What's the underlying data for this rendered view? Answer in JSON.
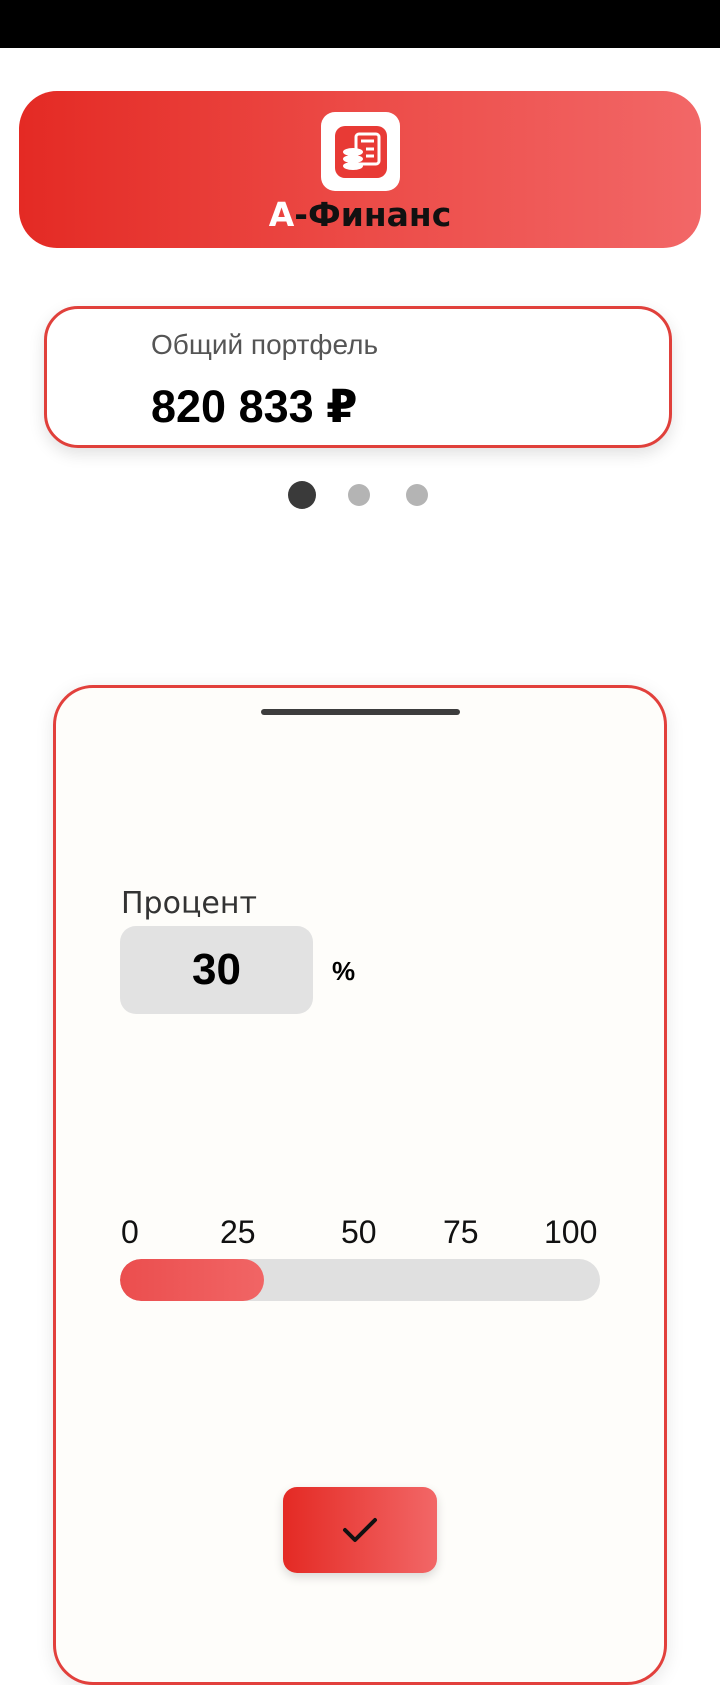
{
  "header": {
    "app_name_accent": "А",
    "app_name_rest": "-Финанс",
    "logo_icon": "finance-coins-icon"
  },
  "portfolio": {
    "label": "Общий портфель",
    "value": "820 833 ₽"
  },
  "pager": {
    "pages": 3,
    "active": 0
  },
  "sheet": {
    "percent_label": "Процент",
    "percent_value": "30",
    "percent_unit": "%",
    "scale_labels": [
      "0",
      "25",
      "50",
      "75",
      "100"
    ],
    "slider_value": 30,
    "slider_max": 100,
    "confirm_icon": "checkmark-icon"
  },
  "colors": {
    "brand_red": "#e42a24",
    "brand_red_light": "#f26767",
    "input_bg": "#e2e2e2"
  }
}
